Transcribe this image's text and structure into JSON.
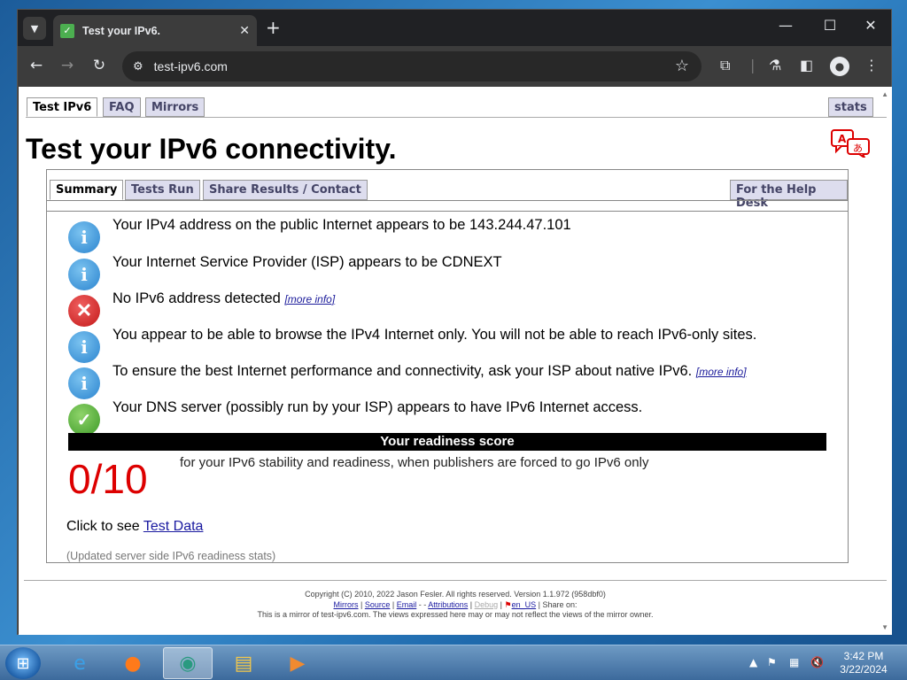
{
  "browser": {
    "tab_title": "Test your IPv6.",
    "url": "test-ipv6.com",
    "new_tab_symbol": "+",
    "close_tab_symbol": "✕"
  },
  "page": {
    "top_tabs": {
      "test_ipv6": "Test IPv6",
      "faq": "FAQ",
      "mirrors": "Mirrors",
      "stats": "stats"
    },
    "heading": "Test your IPv6 connectivity.",
    "sub_tabs": {
      "summary": "Summary",
      "tests_run": "Tests Run",
      "share": "Share Results / Contact",
      "help_desk": "For the Help Desk"
    },
    "results": [
      {
        "status": "info",
        "text": "Your IPv4 address on the public Internet appears to be 143.244.47.101",
        "more": ""
      },
      {
        "status": "info",
        "text": "Your Internet Service Provider (ISP) appears to be CDNEXT",
        "more": ""
      },
      {
        "status": "error",
        "text": "No IPv6 address detected",
        "more": "[more info]"
      },
      {
        "status": "info",
        "text": "You appear to be able to browse the IPv4 Internet only. You will not be able to reach IPv6-only sites.",
        "more": ""
      },
      {
        "status": "info",
        "text": "To ensure the best Internet performance and connectivity, ask your ISP about native IPv6.",
        "more": "[more info]"
      },
      {
        "status": "ok",
        "text": "Your DNS server (possibly run by your ISP) appears to have IPv6 Internet access.",
        "more": ""
      }
    ],
    "readiness_title": "Your readiness score",
    "score": "0/10",
    "score_desc": "for your IPv6 stability and readiness, when publishers are forced to go IPv6 only",
    "click_to_see": "Click to see",
    "test_data_link": "Test Data",
    "updated_note": "(Updated server side IPv6 readiness stats)",
    "footer": {
      "copyright": "Copyright (C) 2010, 2022 Jason Fesler. All rights reserved. Version 1.1.972 (958dbf0)",
      "mirrors": "Mirrors",
      "source": "Source",
      "email": "Email",
      "attributions": "Attributions",
      "debug": "Debug",
      "locale": "en_US",
      "share_on": "Share on:",
      "mirror_note": "This is a mirror of test-ipv6.com. The views expressed here may or may not reflect the views of the mirror owner."
    }
  },
  "taskbar": {
    "time": "3:42 PM",
    "date": "3/22/2024"
  }
}
